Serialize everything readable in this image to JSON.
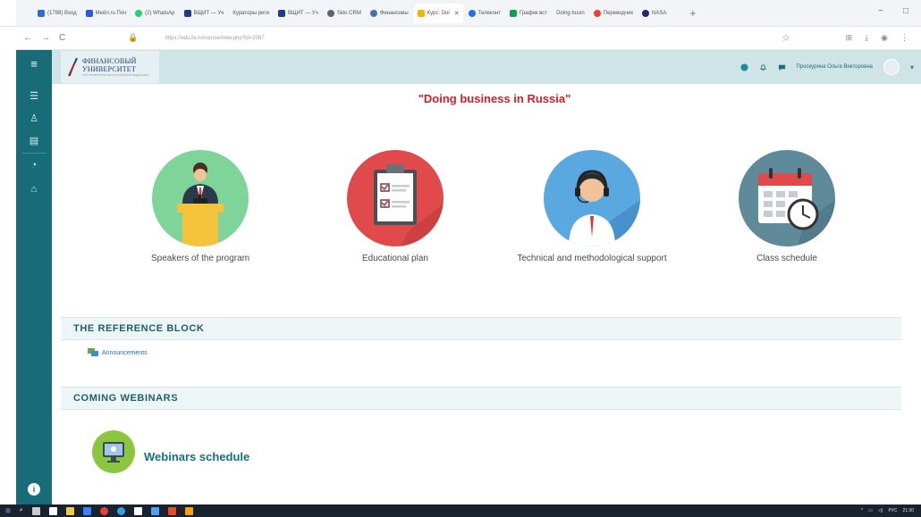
{
  "browser": {
    "tabs": [
      {
        "label": "(1798) Вход",
        "color": "#2b6fd6"
      },
      {
        "label": "Мейл.ru Поч",
        "color": "#2a5bd7"
      },
      {
        "label": "(2) WhatsAp",
        "color": "#25d366"
      },
      {
        "label": "ВЩИТ — Уч",
        "color": "#1e3a8a"
      },
      {
        "label": "Кураторы реги",
        "color": "#9aa0a6"
      },
      {
        "label": "ВЩИТ — Уч",
        "color": "#1e3a8a"
      },
      {
        "label": "Sklo CRM",
        "color": "#5c6670"
      },
      {
        "label": "Финансовы",
        "color": "#4a6fa5"
      },
      {
        "label": "Курс: Doi",
        "color": "#f4b400",
        "active": true
      },
      {
        "label": "Телеконт",
        "color": "#1a73e8"
      },
      {
        "label": "График вст",
        "color": "#0f9d58"
      },
      {
        "label": "Doing busin",
        "color": "#9aa0a6"
      },
      {
        "label": "Переводчик",
        "color": "#e94235"
      },
      {
        "label": "NASA",
        "color": "#1c2a6b"
      }
    ],
    "url": "https://edu.fa.ru/course/view.php?id=2087",
    "window_controls": [
      "−",
      "□"
    ]
  },
  "header": {
    "logo_line1": "ФИНАНСОВЫЙ",
    "logo_line2": "УНИВЕРСИТЕТ",
    "logo_sub": "ПРИ ПРАВИТЕЛЬСТВЕ РОССИЙСКОЙ ФЕДЕРАЦИИ",
    "user_name": "Проскурина Ольга Викторовна"
  },
  "main": {
    "title": "\"Doing business in Russia\"",
    "cards": [
      {
        "label": "Speakers of the program",
        "color": "#7fd49a"
      },
      {
        "label": "Educational plan",
        "color": "#e04a4a"
      },
      {
        "label": "Technical and methodological support",
        "color": "#5aa8e0"
      },
      {
        "label": "Class schedule",
        "color": "#5f8a9a"
      }
    ]
  },
  "reference_block": {
    "heading": "THE REFERENCE BLOCK",
    "link": "Announcements"
  },
  "webinars": {
    "heading": "COMING WEBINARS",
    "link": "Webinars schedule"
  },
  "taskbar": {
    "tray_lang": "РУС",
    "time": "21:30"
  }
}
